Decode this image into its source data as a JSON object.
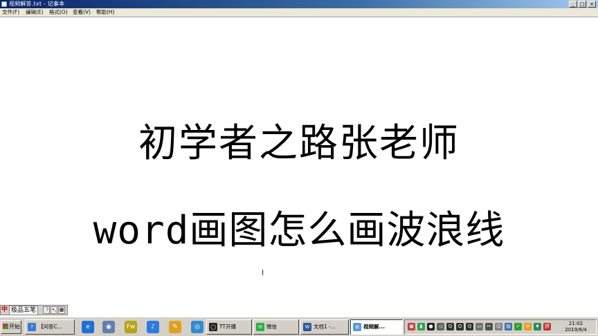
{
  "window": {
    "title": "视频解答.txt - 记事本",
    "controls": {
      "minimize": "_",
      "maximize": "□",
      "close": "×"
    }
  },
  "menu": [
    {
      "label": "文件(F)"
    },
    {
      "label": "编辑(E)"
    },
    {
      "label": "格式(O)"
    },
    {
      "label": "查看(V)"
    },
    {
      "label": "帮助(H)"
    }
  ],
  "document": {
    "line1": "初学者之路张老师",
    "line2_latin": "word",
    "line2_cjk": "画图怎么画波浪线"
  },
  "ime": {
    "logo": "中",
    "name": "极品五笔",
    "mode_moon": "☽",
    "mode_dots": "•,",
    "mode_kbd": "▦"
  },
  "taskbar": {
    "start_label": "开始",
    "quick_launch": [
      {
        "icon": "ie-icon",
        "glyph": "e",
        "color": "#1e6fd6"
      },
      {
        "icon": "explorer-icon",
        "glyph": "◉",
        "color": "#5f7fae"
      },
      {
        "icon": "fireworks-icon",
        "glyph": "Fw",
        "color": "#b7a21a"
      },
      {
        "icon": "music-note-icon",
        "glyph": "♪",
        "color": "#2c7be0"
      },
      {
        "icon": "pen-tool-icon",
        "glyph": "✎",
        "color": "#e0a020"
      },
      {
        "icon": "media-disc-icon",
        "glyph": "◎",
        "color": "#2f8bd0"
      }
    ],
    "windows": [
      {
        "label": "【问答C...",
        "icon": "question-icon",
        "glyph": "?",
        "color": "#3a7ad0",
        "active": false
      },
      {
        "label": "TT开播",
        "icon": "broadcast-icon",
        "glyph": "◯",
        "color": "#222222",
        "active": false
      },
      {
        "label": "微信",
        "icon": "wechat-icon",
        "glyph": "✉",
        "color": "#2aae3e",
        "active": false
      },
      {
        "label": "文档1 -...",
        "icon": "word-icon",
        "glyph": "W",
        "color": "#2b5797",
        "active": false
      },
      {
        "label": "视频解...",
        "icon": "notepad-icon",
        "glyph": "≡",
        "color": "#5b9bd5",
        "active": true
      }
    ],
    "tray_icons": [
      {
        "icon": "tray-app-icon-1",
        "glyph": "▣",
        "color": "#c04040"
      },
      {
        "icon": "tray-app-icon-2",
        "glyph": "▮",
        "color": "#30a050"
      },
      {
        "icon": "tray-record-icon",
        "glyph": "●",
        "color": "#202020"
      },
      {
        "icon": "tray-volume-icon",
        "glyph": "◁",
        "color": "#606060"
      },
      {
        "icon": "tray-qq-icon-1",
        "glyph": "Q",
        "color": "#303030"
      },
      {
        "icon": "tray-qq-icon-2",
        "glyph": "Q",
        "color": "#303030"
      },
      {
        "icon": "tray-qq-icon-3",
        "glyph": "Q",
        "color": "#303030"
      },
      {
        "icon": "tray-disk-icon",
        "glyph": "▭",
        "color": "#707070"
      },
      {
        "icon": "tray-tool-icon",
        "glyph": "✂",
        "color": "#505050"
      },
      {
        "icon": "tray-chat-icon",
        "glyph": "☺",
        "color": "#808080"
      },
      {
        "icon": "tray-network-icon",
        "glyph": "▤",
        "color": "#3a70b0"
      },
      {
        "icon": "tray-security-icon",
        "glyph": "✓",
        "color": "#30a030"
      },
      {
        "icon": "tray-update-icon",
        "glyph": "⟳",
        "color": "#e0a020"
      },
      {
        "icon": "tray-shield-icon",
        "glyph": "♦",
        "color": "#2a8c5a"
      },
      {
        "icon": "tray-ime-icon",
        "glyph": "拼",
        "color": "#c03030"
      }
    ],
    "clock_time": "21:02",
    "clock_date": "2019/6/4"
  }
}
